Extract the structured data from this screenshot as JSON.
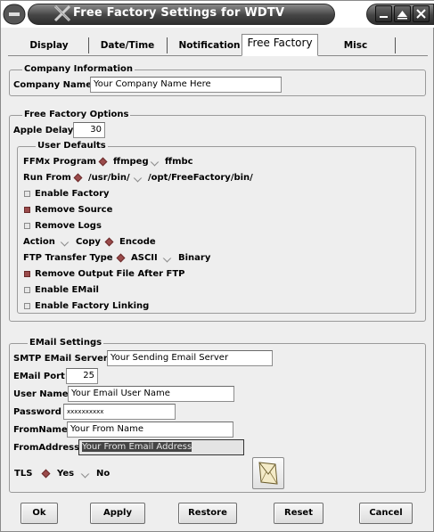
{
  "window": {
    "title": "Free Factory Settings for WDTV",
    "icons": [
      "app-x-icon",
      "minimize-icon",
      "maximize-icon",
      "close-icon"
    ]
  },
  "tabs": [
    {
      "label": "Display",
      "active": false
    },
    {
      "label": "Date/Time",
      "active": false
    },
    {
      "label": "Notification",
      "active": false
    },
    {
      "label": "Free Factory",
      "active": true
    },
    {
      "label": "Misc",
      "active": false
    }
  ],
  "company": {
    "group_label": "Company Information",
    "name_label": "Company Name",
    "name_value": "Your Company Name Here"
  },
  "options": {
    "group_label": "Free Factory Options",
    "apple_delay_label": "Apple Delay",
    "apple_delay_value": "30",
    "user_defaults": {
      "group_label": "User Defaults",
      "ffmx_label": "FFMx Program",
      "ffmx_options": [
        {
          "label": "ffmpeg",
          "selected": true
        },
        {
          "label": "ffmbc",
          "selected": false
        }
      ],
      "run_from_label": "Run From",
      "run_from_options": [
        {
          "label": "/usr/bin/",
          "selected": true
        },
        {
          "label": "/opt/FreeFactory/bin/",
          "selected": false
        }
      ],
      "checks": [
        {
          "label": "Enable Factory",
          "checked": false
        },
        {
          "label": "Remove Source",
          "checked": true
        },
        {
          "label": "Remove Logs",
          "checked": false
        }
      ],
      "action_label": "Action",
      "action_options": [
        {
          "label": "Copy",
          "selected": false
        },
        {
          "label": "Encode",
          "selected": true
        }
      ],
      "ftp_label": "FTP Transfer Type",
      "ftp_options": [
        {
          "label": "ASCII",
          "selected": true
        },
        {
          "label": "Binary",
          "selected": false
        }
      ],
      "checks2": [
        {
          "label": "Remove Output File After FTP",
          "checked": true
        },
        {
          "label": "Enable EMail",
          "checked": false
        },
        {
          "label": "Enable Factory Linking",
          "checked": false
        }
      ]
    }
  },
  "email": {
    "group_label": "EMail Settings",
    "smtp_label": "SMTP EMail Server",
    "smtp_value": "Your Sending Email Server",
    "port_label": "EMail Port",
    "port_value": "25",
    "user_label": "User Name",
    "user_value": "Your Email User Name",
    "password_label": "Password",
    "password_value": "xxxxxxxxxx",
    "fromname_label": "FromName",
    "fromname_value": "Your From Name",
    "fromaddress_label": "FromAddress",
    "fromaddress_value": "Your From Email Address",
    "tls_label": "TLS",
    "tls_options": [
      {
        "label": "Yes",
        "selected": true
      },
      {
        "label": "No",
        "selected": false
      }
    ],
    "test_icon": "envelope-icon"
  },
  "buttons": {
    "ok": "Ok",
    "apply": "Apply",
    "restore": "Restore",
    "reset": "Reset",
    "cancel": "Cancel"
  },
  "colors": {
    "accent": "#9b4b4b",
    "titlebar": "#3d3d3d",
    "background": "#eeeeee"
  }
}
